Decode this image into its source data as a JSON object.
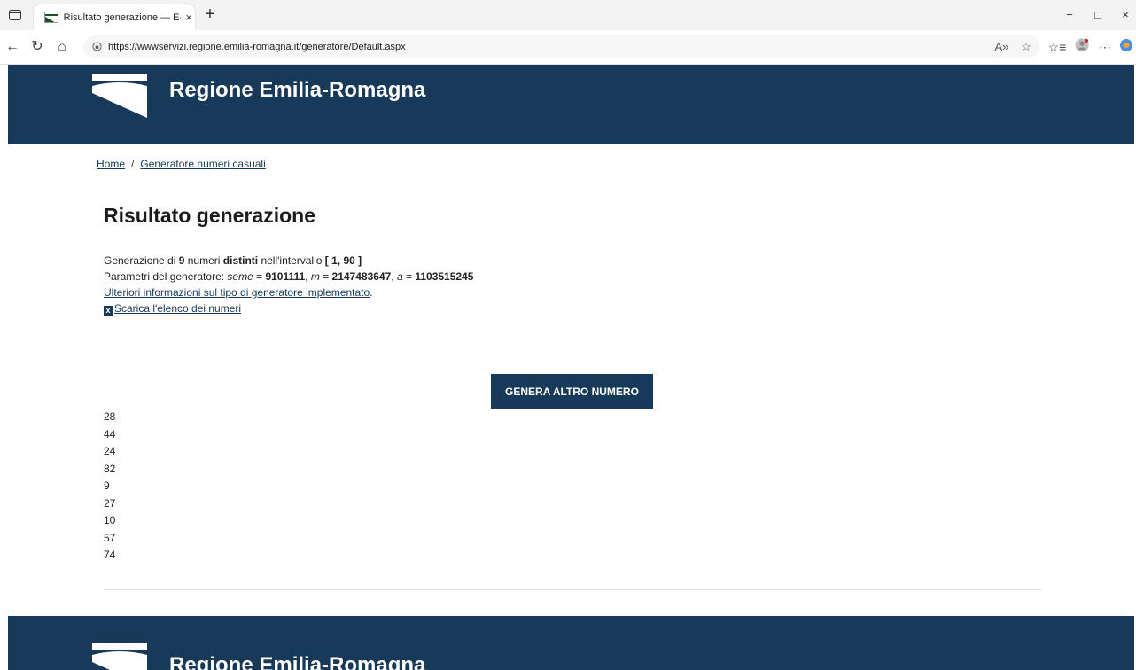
{
  "browser": {
    "tab_title": "Risultato generazione — E-R Il po",
    "tab_close": "×",
    "new_tab": "+",
    "url": "https://wwwservizi.regione.emilia-romagna.it/generatore/Default.aspx",
    "win_min": "−",
    "win_max": "□",
    "win_close": "×"
  },
  "header": {
    "title": "Regione Emilia-Romagna"
  },
  "breadcrumb": {
    "home": "Home",
    "separator": "/",
    "current": "Generatore numeri casuali"
  },
  "main": {
    "title": "Risultato generazione",
    "line1": {
      "prefix": "Generazione di ",
      "count": "9",
      "mid1": " numeri ",
      "distinct": "distinti",
      "mid2": " nell'intervallo ",
      "interval": "[ 1, 90 ]"
    },
    "line2": {
      "prefix": "Parametri del generatore: ",
      "seed_label": "seme",
      "eq": " = ",
      "seed_value": "9101111",
      "comma1": ", ",
      "m_label": "m",
      "m_value": "2147483647",
      "comma2": ", ",
      "a_label": "a",
      "a_value": "1103515245"
    },
    "info_link": "Ulteriori informazioni sul tipo di generatore implementato",
    "info_link_suffix": ".",
    "download_link": "Scarica l'elenco dei numeri",
    "generate_button": "GENERA ALTRO NUMERO",
    "numbers": [
      "28",
      "44",
      "24",
      "82",
      "9",
      "27",
      "10",
      "57",
      "74"
    ]
  },
  "footer": {
    "title": "Regione Emilia-Romagna"
  },
  "colors": {
    "brand": "#17395a"
  }
}
